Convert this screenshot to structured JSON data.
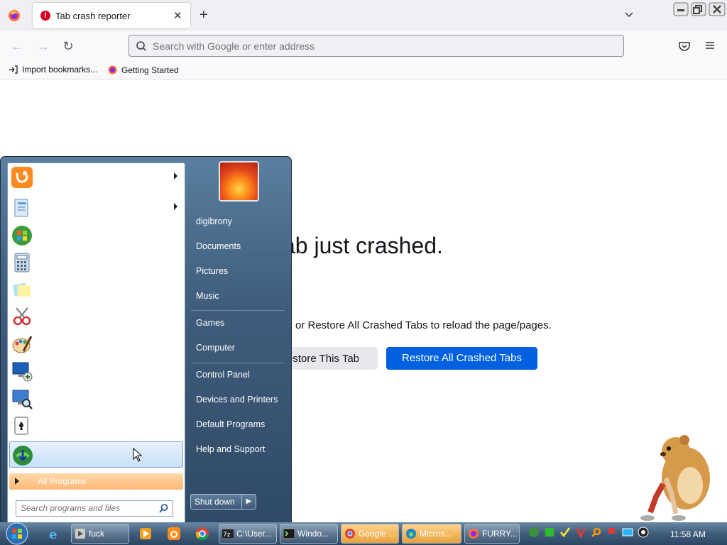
{
  "browser": {
    "tab_title": "Tab crash reporter",
    "url_placeholder": "Search with Google or enter address",
    "bookmarks": [
      {
        "label": "Import bookmarks...",
        "icon": "import-icon"
      },
      {
        "label": "Getting Started",
        "icon": "firefox-icon"
      }
    ]
  },
  "crash_page": {
    "title": "ab just crashed.",
    "description": "or Restore All Crashed Tabs to reload the page/pages.",
    "restore_this": "estore This Tab",
    "restore_all": "Restore All Crashed Tabs",
    "colors": {
      "primary_button": "#0061e0"
    }
  },
  "start_menu": {
    "programs": [
      {
        "name": "uc-browser-icon",
        "submenu": true
      },
      {
        "name": "getting-started-icon",
        "submenu": true
      },
      {
        "name": "windows-update-icon",
        "submenu": false
      },
      {
        "name": "calculator-icon",
        "submenu": false
      },
      {
        "name": "sticky-notes-icon",
        "submenu": false
      },
      {
        "name": "snipping-tool-icon",
        "submenu": false
      },
      {
        "name": "paint-icon",
        "submenu": false
      },
      {
        "name": "remote-desktop-icon",
        "submenu": false
      },
      {
        "name": "magnifier-icon",
        "submenu": false
      },
      {
        "name": "solitaire-icon",
        "submenu": false
      },
      {
        "name": "internet-download-manager-icon",
        "submenu": false
      }
    ],
    "all_programs": "All Programs",
    "search_placeholder": "Search programs and files",
    "right_links": [
      "digibrony",
      "Documents",
      "Pictures",
      "Music",
      "Games",
      "Computer",
      "Control Panel",
      "Devices and Printers",
      "Default Programs",
      "Help and Support"
    ],
    "shutdown": "Shut down"
  },
  "taskbar": {
    "buttons": [
      {
        "label": "fuck",
        "icon": "media-icon"
      },
      {
        "label": "C:\\User...",
        "icon": "7zip-icon"
      },
      {
        "label": "Windo...",
        "icon": "terminal-icon"
      },
      {
        "label": "Google ...",
        "icon": "chrome-icon"
      },
      {
        "label": "Micros...",
        "icon": "edge-icon"
      },
      {
        "label": "FURRY...",
        "icon": "firefox-icon"
      }
    ],
    "clock": "11:58 AM"
  }
}
